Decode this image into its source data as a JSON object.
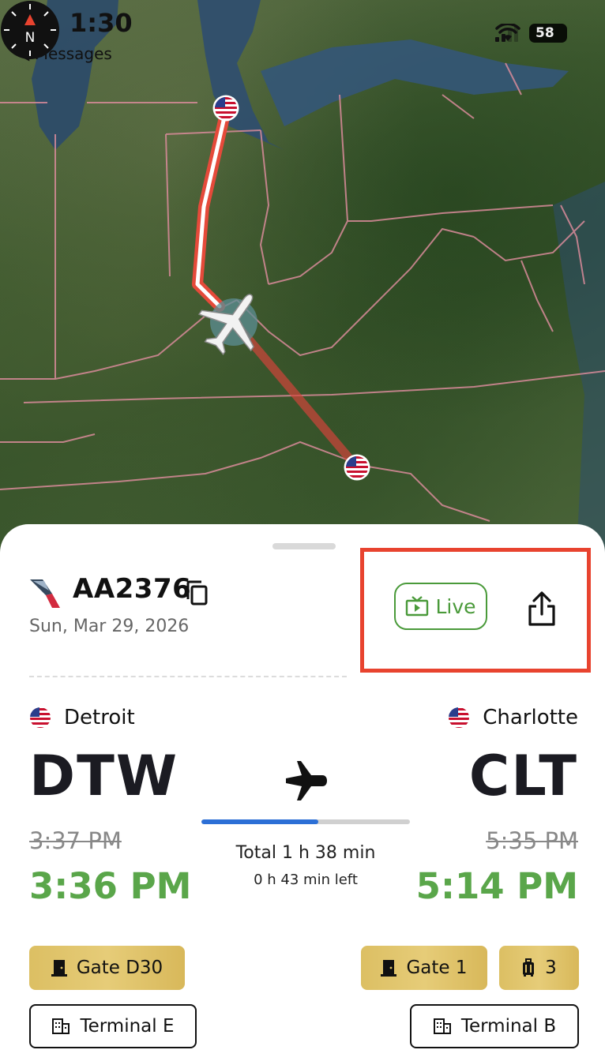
{
  "status_bar": {
    "time": "1:30",
    "back_app": "◀ Messages",
    "battery": "58"
  },
  "map": {
    "icons": [
      "back-arrow-icon",
      "compass-icon",
      "us-flag-icon",
      "airplane-icon"
    ]
  },
  "flight": {
    "number": "AA2376",
    "date": "Sun, Mar 29, 2026",
    "live_label": "Live",
    "progress": 0.56
  },
  "departure": {
    "city": "Detroit",
    "code": "DTW",
    "scheduled": "3:37 PM",
    "actual": "3:36 PM",
    "gate": "Gate D30",
    "terminal": "Terminal E"
  },
  "arrival": {
    "city": "Charlotte",
    "code": "CLT",
    "scheduled": "5:35 PM",
    "actual": "5:14 PM",
    "gate": "Gate 1",
    "baggage": "3",
    "terminal": "Terminal B"
  },
  "duration": {
    "total": "Total 1 h 38 min",
    "left": "0 h 43 min left"
  },
  "colors": {
    "accent_green": "#5aa64a",
    "gold": "#dcbf63",
    "highlight": "#e8432f",
    "progress": "#2c6fd6"
  }
}
